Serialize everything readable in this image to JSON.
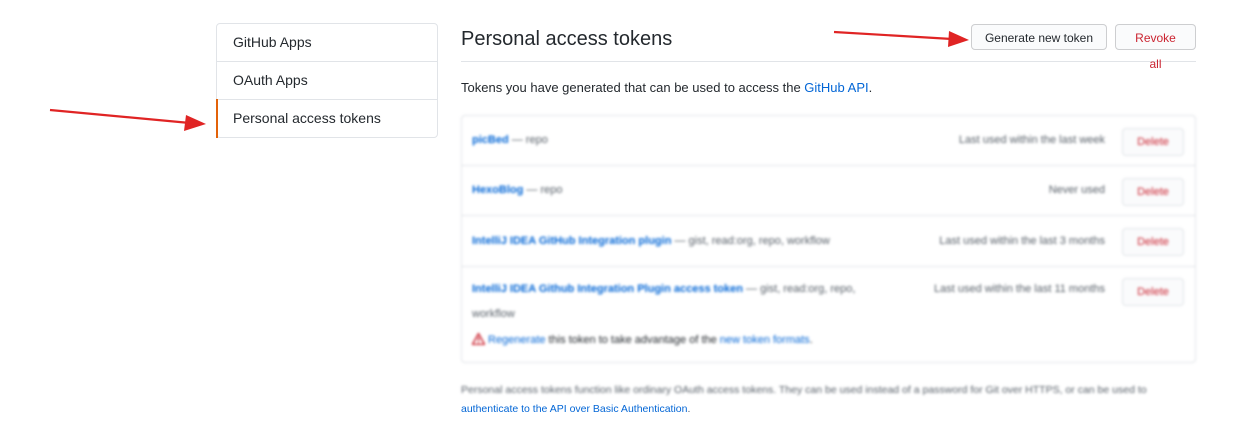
{
  "sidebar": {
    "items": [
      {
        "label": "GitHub Apps"
      },
      {
        "label": "OAuth Apps"
      },
      {
        "label": "Personal access tokens",
        "selected": true
      }
    ]
  },
  "main": {
    "title": "Personal access tokens",
    "generate_label": "Generate new token",
    "revoke_label": "Revoke all",
    "intro_text": "Tokens you have generated that can be used to access the ",
    "intro_link": "GitHub API",
    "intro_end": "."
  },
  "tokens": [
    {
      "name": "picBed",
      "scopes": " — repo",
      "last_used": "Last used within the last week",
      "delete_label": "Delete"
    },
    {
      "name": "HexoBlog",
      "scopes": " — repo",
      "last_used": "Never used",
      "delete_label": "Delete"
    },
    {
      "name": "IntelliJ IDEA GitHub Integration plugin",
      "scopes": " — gist, read:org, repo, workflow",
      "last_used": "Last used within the last 3 months",
      "delete_label": "Delete"
    },
    {
      "name": "IntelliJ IDEA Github Integration Plugin access token",
      "scopes": " — gist, read:org, repo,",
      "scopes_wrap": "workflow",
      "last_used": "Last used within the last 11 months",
      "delete_label": "Delete",
      "regen_link": "Regenerate",
      "regen_text": " this token to take advantage of the ",
      "regen_link2": "new token formats",
      "regen_end": "."
    }
  ],
  "footnote": {
    "text": "Personal access tokens function like ordinary OAuth access tokens. They can be used instead of a password for Git over HTTPS, or can be used to ",
    "link": "authenticate to the API over Basic Authentication",
    "end": "."
  },
  "colors": {
    "accent": "#0366d6",
    "danger": "#cb2431",
    "arrow": "#e02424",
    "selected_bar": "#e36209"
  }
}
